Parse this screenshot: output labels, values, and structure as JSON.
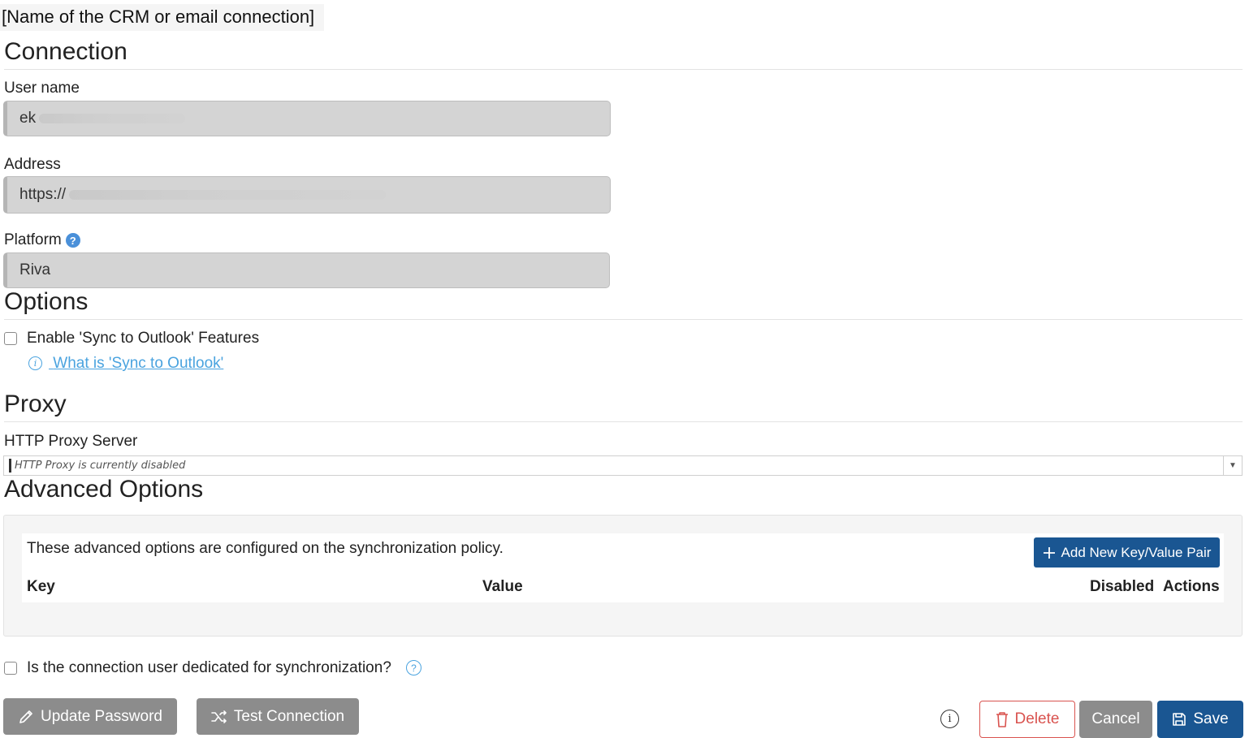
{
  "page": {
    "title": "[Name of the CRM or email connection]"
  },
  "connection": {
    "section_title": "Connection",
    "username_label": "User name",
    "username_value": "ek",
    "address_label": "Address",
    "address_value": "https://",
    "platform_label": "Platform",
    "platform_help": "?",
    "platform_value": "Riva"
  },
  "options": {
    "section_title": "Options",
    "sync_outlook_label": "Enable 'Sync to Outlook' Features",
    "sync_outlook_checked": false,
    "sync_outlook_link": "What is 'Sync to Outlook'"
  },
  "proxy": {
    "section_title": "Proxy",
    "server_label": "HTTP Proxy Server",
    "server_placeholder": "HTTP Proxy is currently disabled"
  },
  "advanced": {
    "section_title": "Advanced Options",
    "description": "These advanced options are configured on the synchronization policy.",
    "add_button_label": "Add New Key/Value Pair",
    "columns": [
      "Key",
      "Value",
      "Disabled",
      "Actions"
    ]
  },
  "dedicated": {
    "label": "Is the connection user dedicated for synchronization?",
    "checked": false,
    "help": "?"
  },
  "actions": {
    "update_password": "Update Password",
    "test_connection": "Test Connection",
    "delete": "Delete",
    "cancel": "Cancel",
    "save": "Save"
  },
  "colors": {
    "primary": "#1a5692",
    "danger": "#d9534f",
    "link": "#4aa3df",
    "secondary": "#8c8c8c"
  }
}
